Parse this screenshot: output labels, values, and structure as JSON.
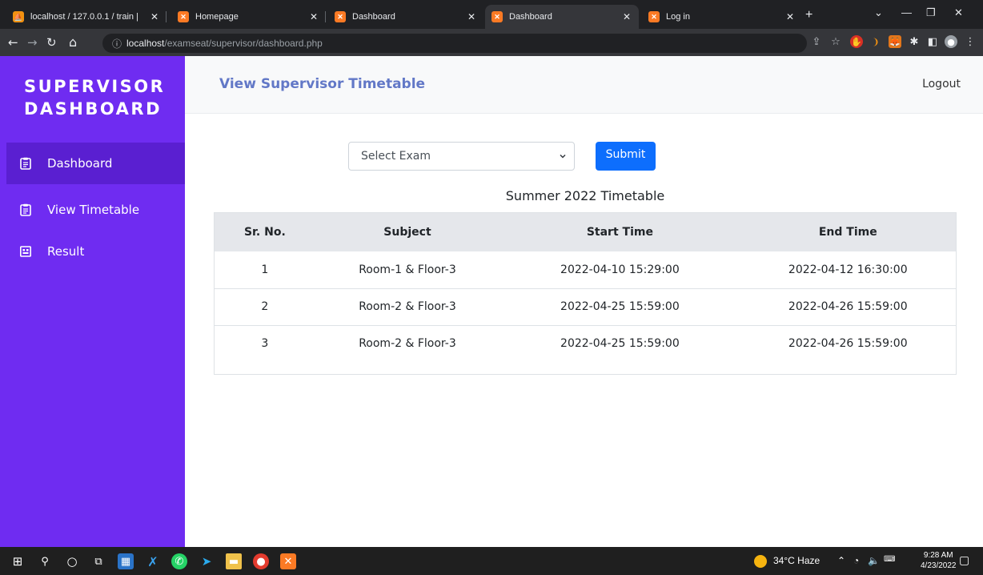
{
  "browser": {
    "tabs": [
      {
        "title": "localhost / 127.0.0.1 / train |",
        "icon": "phpmyadmin-icon",
        "active": false
      },
      {
        "title": "Homepage",
        "icon": "xampp-icon",
        "active": false
      },
      {
        "title": "Dashboard",
        "icon": "xampp-icon",
        "active": false
      },
      {
        "title": "Dashboard",
        "icon": "xampp-icon",
        "active": true
      },
      {
        "title": "Log in",
        "icon": "xampp-icon",
        "active": false
      }
    ],
    "url_host": "localhost",
    "url_path": "/examseat/supervisor/dashboard.php"
  },
  "sidebar": {
    "brand_line1": "SUPERVISOR",
    "brand_line2": "DASHBOARD",
    "items": [
      {
        "label": "Dashboard",
        "icon": "clipboard-icon",
        "active": true
      },
      {
        "label": "View Timetable",
        "icon": "clipboard-icon",
        "active": false
      },
      {
        "label": "Result",
        "icon": "result-icon",
        "active": false
      }
    ]
  },
  "header": {
    "title": "View Supervisor Timetable",
    "logout_label": "Logout"
  },
  "form": {
    "select_value": "Select Exam",
    "submit_label": "Submit"
  },
  "timetable": {
    "title": "Summer 2022 Timetable",
    "columns": [
      "Sr. No.",
      "Subject",
      "Start Time",
      "End Time"
    ],
    "rows": [
      [
        "1",
        "Room-1 & Floor-3",
        "2022-04-10 15:29:00",
        "2022-04-12 16:30:00"
      ],
      [
        "2",
        "Room-2 & Floor-3",
        "2022-04-25 15:59:00",
        "2022-04-26 15:59:00"
      ],
      [
        "3",
        "Room-2 & Floor-3",
        "2022-04-25 15:59:00",
        "2022-04-26 15:59:00"
      ]
    ]
  },
  "taskbar": {
    "weather": "34°C  Haze",
    "time": "9:28 AM",
    "date": "4/23/2022"
  },
  "colors": {
    "sidebar": "#6f2cf1",
    "sidebar_active": "#5a1fd1",
    "title_accent": "#6278c7",
    "primary_button": "#0d6efd"
  }
}
